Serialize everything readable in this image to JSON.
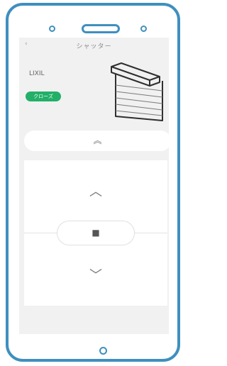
{
  "app": {
    "back_icon": "chevron-left-icon"
  },
  "header": {
    "title": "シャッター"
  },
  "device": {
    "brand": "LIXIL",
    "status": "クローズ",
    "status_color": "#22b068",
    "image_icon": "shutter-icon"
  },
  "controls": {
    "open_all_icon": "double-chevron-up-icon",
    "open_all_symbol": "︽",
    "up_icon": "chevron-up-icon",
    "up_symbol": "︿",
    "stop_icon": "stop-icon",
    "stop_symbol": "■",
    "down_icon": "chevron-down-icon",
    "down_symbol": "﹀"
  },
  "frame": {
    "accent_color": "#3f8fbf"
  }
}
